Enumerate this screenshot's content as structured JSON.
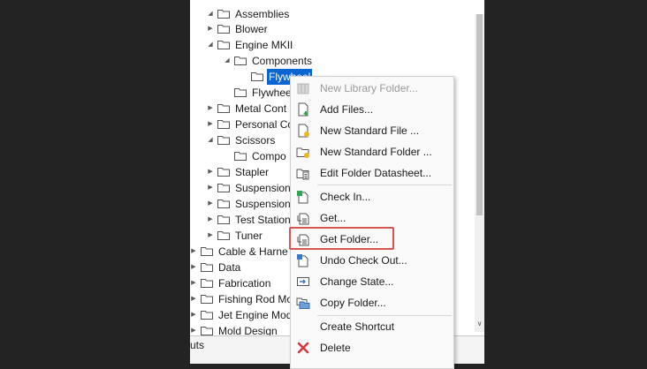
{
  "tree": [
    {
      "label": "Assemblies",
      "expanded": true
    },
    {
      "label": "Blower",
      "expanded": false
    },
    {
      "label": "Engine MKII",
      "expanded": true
    },
    {
      "label": "Components",
      "expanded": true
    },
    {
      "label": "Flywheel",
      "selected": true
    },
    {
      "label": "Flywhee"
    },
    {
      "label": "Metal Cont",
      "expanded": false
    },
    {
      "label": "Personal Co",
      "expanded": false
    },
    {
      "label": "Scissors",
      "expanded": true
    },
    {
      "label": "Compo"
    },
    {
      "label": "Stapler",
      "expanded": false
    },
    {
      "label": "Suspension",
      "expanded": false
    },
    {
      "label": "Suspension",
      "expanded": false
    },
    {
      "label": "Test Station",
      "expanded": false
    },
    {
      "label": "Tuner",
      "expanded": false
    },
    {
      "label": "Cable & Harne",
      "expanded": false
    },
    {
      "label": "Data",
      "expanded": false
    },
    {
      "label": "Fabrication",
      "expanded": false
    },
    {
      "label": "Fishing Rod Mo",
      "expanded": false
    },
    {
      "label": "Jet Engine Mod",
      "expanded": false
    },
    {
      "label": "Mold Design",
      "expanded": false
    }
  ],
  "bottom_bar": {
    "text": "uts"
  },
  "context_menu": {
    "items": [
      {
        "label": "New Library Folder...",
        "icon": "library-folder-icon",
        "disabled": true
      },
      {
        "label": "Add Files...",
        "icon": "add-file-icon"
      },
      {
        "label": "New Standard File ...",
        "icon": "new-file-icon"
      },
      {
        "label": "New Standard Folder ...",
        "icon": "new-folder-icon"
      },
      {
        "label": "Edit Folder Datasheet...",
        "icon": "datasheet-icon"
      },
      {
        "label": "Check In...",
        "icon": "check-in-icon"
      },
      {
        "label": "Get...",
        "icon": "get-icon"
      },
      {
        "label": "Get Folder...",
        "icon": "get-folder-icon",
        "highlighted": true
      },
      {
        "label": "Undo Check Out...",
        "icon": "undo-checkout-icon"
      },
      {
        "label": "Change State...",
        "icon": "change-state-icon"
      },
      {
        "label": "Copy Folder...",
        "icon": "copy-folder-icon"
      },
      {
        "label": "Create Shortcut",
        "icon": "shortcut-icon"
      },
      {
        "label": "Delete",
        "icon": "delete-icon"
      }
    ]
  },
  "colors": {
    "selection": "#0a64d2",
    "highlight_border": "#d9534f",
    "delete_icon": "#d9363e",
    "background": "#232323"
  }
}
